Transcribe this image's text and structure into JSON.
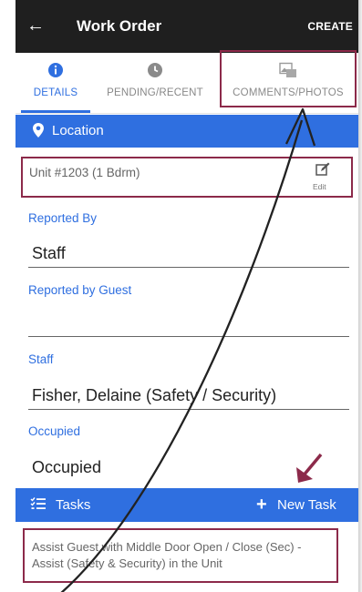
{
  "header": {
    "back_icon": "arrow-left-icon",
    "title": "Work Order",
    "create_label": "CREATE"
  },
  "tabs": [
    {
      "label": "DETAILS",
      "icon": "info-icon",
      "active": true
    },
    {
      "label": "PENDING/RECENT",
      "icon": "clock-icon",
      "active": false
    },
    {
      "label": "COMMENTS/PHOTOS",
      "icon": "photo-icon",
      "active": false
    }
  ],
  "location": {
    "section_label": "Location",
    "icon": "map-pin-icon",
    "unit": "Unit #1203 (1 Bdrm)",
    "edit_label": "Edit"
  },
  "fields": {
    "reported_by": {
      "label": "Reported By",
      "value": "Staff"
    },
    "reported_by_guest": {
      "label": "Reported by Guest",
      "value": ""
    },
    "staff": {
      "label": "Staff",
      "value": "Fisher, Delaine (Safety / Security)"
    },
    "occupied": {
      "label": "Occupied",
      "value": "Occupied"
    }
  },
  "tasks": {
    "section_label": "Tasks",
    "icon": "list-icon",
    "new_task_label": "New Task",
    "items": [
      {
        "text": "Assist Guest with Middle Door Open / Close (Sec) - Assist (Safety & Security) in the Unit"
      }
    ]
  },
  "colors": {
    "accent": "#2f6fe0",
    "header_bg": "#1f1f1f",
    "annotation_box": "#8c2a4a",
    "annotation_line": "#222222",
    "annotation_arrow": "#8c2a4a"
  }
}
